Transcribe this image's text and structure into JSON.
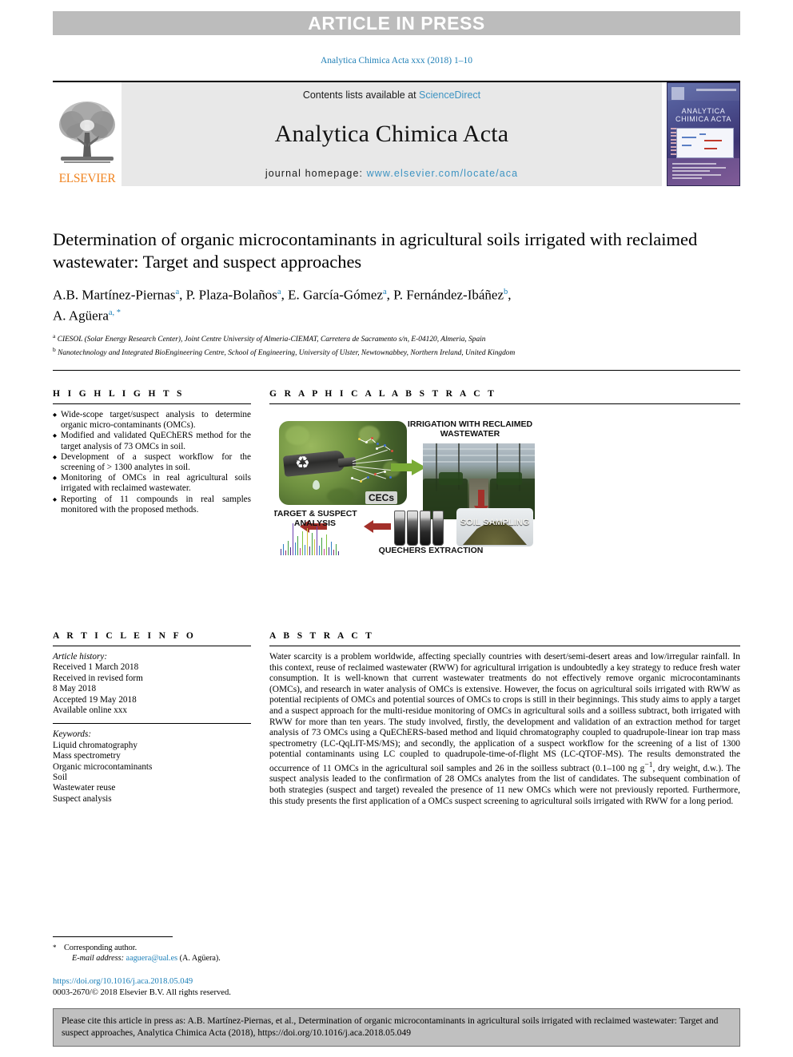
{
  "banner": {
    "text": "ARTICLE IN PRESS"
  },
  "journal_ref": "Analytica Chimica Acta xxx (2018) 1–10",
  "masthead": {
    "contents_prefix": "Contents lists available at ",
    "sciencedirect": "ScienceDirect",
    "journal_name": "Analytica Chimica Acta",
    "homepage_prefix": "journal homepage: ",
    "homepage_url": "www.elsevier.com/locate/aca",
    "publisher": "ELSEVIER",
    "cover_title": "ANALYTICA CHIMICA ACTA",
    "link_color": "#3c93c2",
    "publisher_color": "#f08421"
  },
  "article": {
    "title": "Determination of organic microcontaminants in agricultural soils irrigated with reclaimed wastewater: Target and suspect approaches",
    "authors": [
      {
        "name": "A.B. Martínez-Piernas",
        "sup": "a",
        "sep": ", "
      },
      {
        "name": "P. Plaza-Bolaños",
        "sup": "a",
        "sep": ", "
      },
      {
        "name": "E. García-Gómez",
        "sup": "a",
        "sep": ", "
      },
      {
        "name": "P. Fernández-Ibáñez",
        "sup": "b",
        "sep": ","
      },
      {
        "name": "A. Agüera",
        "sup": "a, *",
        "sep": ""
      }
    ],
    "affiliations": [
      {
        "marker": "a",
        "text": "CIESOL (Solar Energy Research Center), Joint Centre University of Almeria-CIEMAT, Carretera de Sacramento s/n, E-04120, Almeria, Spain"
      },
      {
        "marker": "b",
        "text": "Nanotechnology and Integrated BioEngineering Centre, School of Engineering, University of Ulster, Newtownabbey, Northern Ireland, United Kingdom"
      }
    ]
  },
  "highlights": {
    "heading": "H I G H L I G H T S",
    "items": [
      "Wide-scope target/suspect analysis to determine organic micro-contaminants (OMCs).",
      "Modified and validated QuEChERS method for the target analysis of 73 OMCs in soil.",
      "Development of a suspect workflow for the screening of > 1300 analytes in soil.",
      "Monitoring of OMCs in real agricultural soils irrigated with reclaimed wastewater.",
      "Reporting of 11 compounds in real samples monitored with the proposed methods."
    ]
  },
  "graphical_abstract": {
    "heading": "G R A P H I C A L   A B S T R A C T",
    "labels": {
      "cecs": "CECs",
      "irrigation": "IRRIGATION WITH RECLAIMED WASTEWATER",
      "soil_sampling": "SOIL SAMPLING",
      "quechers": "QUECHERS EXTRACTION",
      "target_suspect": "TARGET & SUSPECT ANALYSIS"
    }
  },
  "article_info": {
    "heading": "A R T I C L E   I N F O",
    "history_label": "Article history:",
    "history": [
      "Received 1 March 2018",
      "Received in revised form",
      "8 May 2018",
      "Accepted 19 May 2018",
      "Available online xxx"
    ],
    "keywords_label": "Keywords:",
    "keywords": [
      "Liquid chromatography",
      "Mass spectrometry",
      "Organic microcontaminants",
      "Soil",
      "Wastewater reuse",
      "Suspect analysis"
    ]
  },
  "abstract": {
    "heading": "A B S T R A C T",
    "text": "Water scarcity is a problem worldwide, affecting specially countries with desert/semi-desert areas and low/irregular rainfall. In this context, reuse of reclaimed wastewater (RWW) for agricultural irrigation is undoubtedly a key strategy to reduce fresh water consumption. It is well-known that current wastewater treatments do not effectively remove organic microcontaminants (OMCs), and research in water analysis of OMCs is extensive. However, the focus on agricultural soils irrigated with RWW as potential recipients of OMCs and potential sources of OMCs to crops is still in their beginnings. This study aims to apply a target and a suspect approach for the multi-residue monitoring of OMCs in agricultural soils and a soilless subtract, both irrigated with RWW for more than ten years. The study involved, firstly, the development and validation of an extraction method for target analysis of 73 OMCs using a QuEChERS-based method and liquid chromatography coupled to quadrupole-linear ion trap mass spectrometry (LC-QqLIT-MS/MS); and secondly, the application of a suspect workflow for the screening of a list of 1300 potential contaminants using LC coupled to quadrupole-time-of-flight MS (LC-QTOF-MS). The results demonstrated the occurrence of 11 OMCs in the agricultural soil samples and 26 in the soilless subtract (0.1–100 ng g",
    "superscript": "−1",
    "text_after_sup": ", dry weight, d.w.). The suspect analysis leaded to the confirmation of 28 OMCs analytes from the list of candidates. The subsequent combination of both strategies (suspect and target) revealed the presence of 11 new OMCs which were not previously reported. Furthermore, this study presents the first application of a OMCs suspect screening to agricultural soils irrigated with RWW for a long period."
  },
  "footer": {
    "corresponding_author": "Corresponding author.",
    "email_label": "E-mail address:",
    "email": "aaguera@ual.es",
    "email_suffix": "(A. Agüera).",
    "doi": "https://doi.org/10.1016/j.aca.2018.05.049",
    "copyright": "0003-2670/© 2018 Elsevier B.V. All rights reserved."
  },
  "citation_box": {
    "text": "Please cite this article in press as: A.B. Martínez-Piernas, et al., Determination of organic microcontaminants in agricultural soils irrigated with reclaimed wastewater: Target and suspect approaches, Analytica Chimica Acta (2018), https://doi.org/10.1016/j.aca.2018.05.049"
  }
}
